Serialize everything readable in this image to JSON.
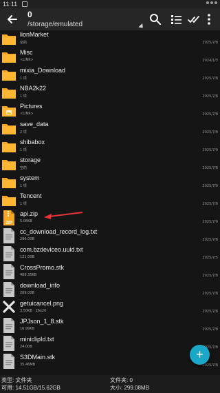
{
  "status": {
    "time": "11:11"
  },
  "toolbar": {
    "title": "0",
    "path": "/storage/emulated"
  },
  "files": [
    {
      "name": "lionMarket",
      "sub": "空的",
      "date": "2025/7/8",
      "kind": "folder"
    },
    {
      "name": "Misc",
      "sub": "<LINK>",
      "date": "2024/1/3",
      "kind": "folder"
    },
    {
      "name": "mixia_Download",
      "sub": "1 项",
      "date": "2025/7/8",
      "kind": "folder"
    },
    {
      "name": "NBA2k22",
      "sub": "1 项",
      "date": "2025/7/8",
      "kind": "folder"
    },
    {
      "name": "Pictures",
      "sub": "<LINK>",
      "date": "2025/7/8",
      "kind": "folder-img"
    },
    {
      "name": "save_data",
      "sub": "2 项",
      "date": "2025/7/8",
      "kind": "folder"
    },
    {
      "name": "shibabox",
      "sub": "1 项",
      "date": "2025/7/9",
      "kind": "folder"
    },
    {
      "name": "storage",
      "sub": "空的",
      "date": "2025/7/8",
      "kind": "folder"
    },
    {
      "name": "system",
      "sub": "1 项",
      "date": "2025/7/9",
      "kind": "folder"
    },
    {
      "name": "Tencent",
      "sub": "1 项",
      "date": "2025/7/8",
      "kind": "folder"
    },
    {
      "name": "api.zip",
      "sub": "5.06KB",
      "date": "2025/7/9",
      "kind": "zip"
    },
    {
      "name": "cc_download_record_log.txt",
      "sub": "296.00B",
      "date": "2025/7/8",
      "kind": "doc"
    },
    {
      "name": "com.bzdeviceo.uuid.txt",
      "sub": "121.00B",
      "date": "2025/7/5",
      "kind": "doc"
    },
    {
      "name": "CrossPromo.stk",
      "sub": "488.35KB",
      "date": "2025/7/8",
      "kind": "doc"
    },
    {
      "name": "download_info",
      "sub": "289.00B",
      "date": "2025/7/8",
      "kind": "doc"
    },
    {
      "name": "getuicancel.png",
      "sub": "3.50KB · 26x26",
      "date": "2025/7/8",
      "kind": "image"
    },
    {
      "name": "JPJson_1_8.stk",
      "sub": "16.99KB",
      "date": "2025/7/8",
      "kind": "doc"
    },
    {
      "name": "miniclipId.txt",
      "sub": "24.00B",
      "date": "2025/7/8",
      "kind": "doc"
    },
    {
      "name": "S3DMain.stk",
      "sub": "35.46MB",
      "date": "2025/7/8",
      "kind": "doc"
    }
  ],
  "footer": {
    "type_label": "类型: 文件夹",
    "usage_label": "可用: 14.51GB/15.62GB",
    "count_label": "文件夹: 0",
    "size_label": "大小: 299.08MB"
  },
  "colors": {
    "folder": "#f7a823",
    "accent": "#1aa7c8",
    "arrow": "#e8343a"
  }
}
